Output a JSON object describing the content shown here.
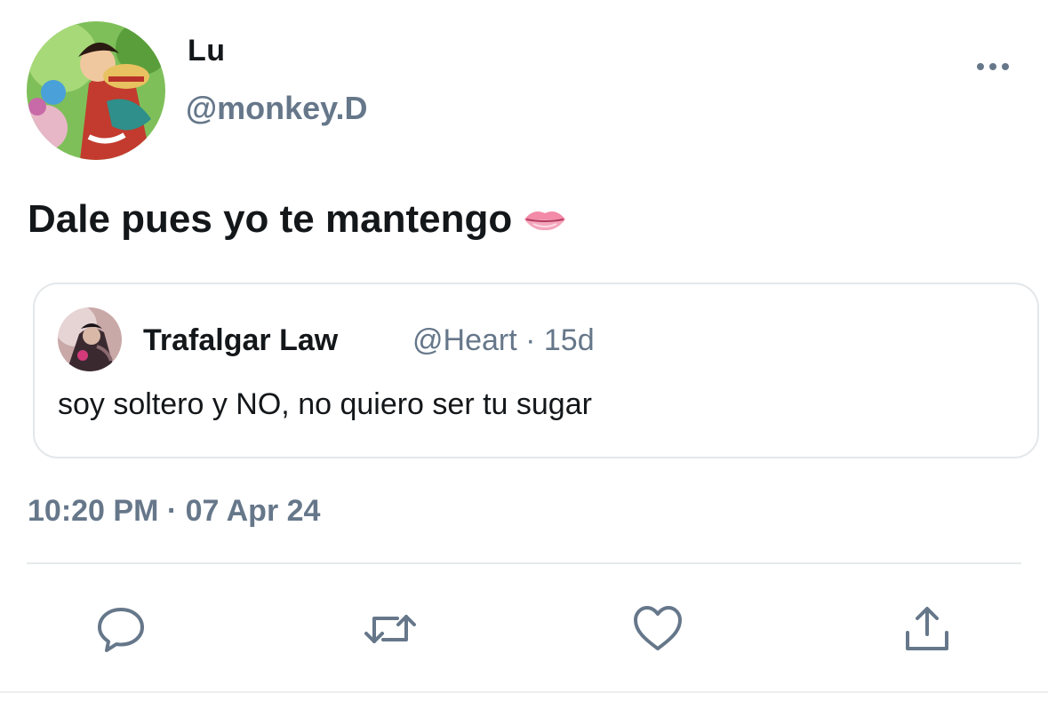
{
  "author": {
    "display_name": "Lu",
    "handle": "@monkey.D",
    "avatar_icon": "anime-character-avatar"
  },
  "tweet": {
    "text": "Dale pues yo te mantengo",
    "emoji_icon": "lips-emoji-icon",
    "timestamp": "10:20 PM · 07 Apr 24"
  },
  "quoted_tweet": {
    "display_name": "Trafalgar Law",
    "meta": "@Heart · 15d",
    "text": "soy soltero y NO, no quiero ser tu sugar",
    "avatar_icon": "anime-character-avatar"
  },
  "actions": {
    "reply_icon": "speech-bubble-icon",
    "retweet_icon": "retweet-arrows-icon",
    "like_icon": "heart-icon",
    "share_icon": "share-upload-icon"
  },
  "colors": {
    "primary_text": "#14171a",
    "secondary_text": "#66778a",
    "border": "#e3e7ea"
  }
}
